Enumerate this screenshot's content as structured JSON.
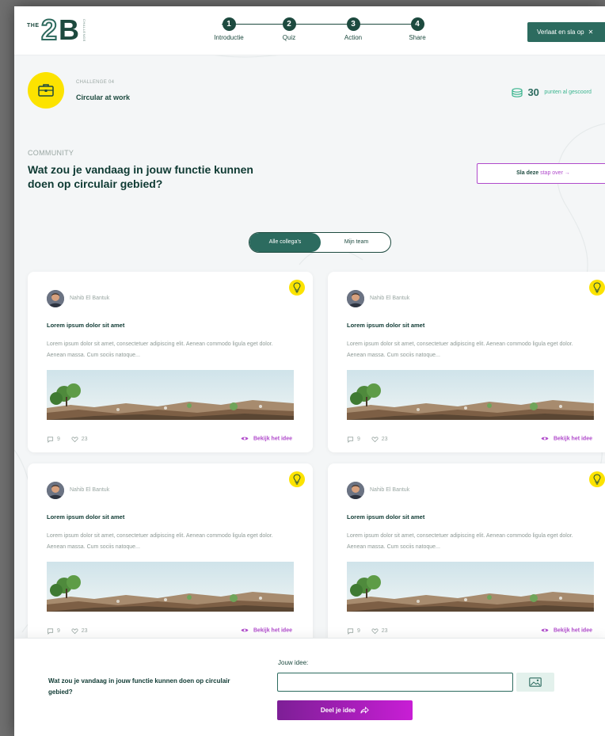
{
  "brand": {
    "the": "THE",
    "two": "2",
    "bee": "B",
    "sub": "CHALLENGE"
  },
  "steps": [
    {
      "num": "1",
      "label": "Introductie"
    },
    {
      "num": "2",
      "label": "Quiz"
    },
    {
      "num": "3",
      "label": "Action"
    },
    {
      "num": "4",
      "label": "Share"
    }
  ],
  "header": {
    "leave_label": "Verlaat en sla op",
    "leave_icon": "close-icon"
  },
  "challenge": {
    "kicker": "CHALLENGE 04",
    "title": "Circular at work",
    "icon": "briefcase-icon"
  },
  "points": {
    "value": "30",
    "text": "punten al gescoord",
    "icon": "coin-stack-icon"
  },
  "section": {
    "kicker": "COMMUNITY",
    "title": "Wat zou je vandaag in jouw functie kunnen doen op circulair gebied?",
    "skip_label": "Sla deze",
    "skip_emphasis": "stap over",
    "skip_arrow": "→"
  },
  "filter": {
    "options": [
      "Alle collega's",
      "Mijn team"
    ],
    "selected": "Alle collega's"
  },
  "cards": [
    {
      "author": "Nahib El Bantuk",
      "title": "Lorem ipsum dolor sit amet",
      "body": "Lorem ipsum dolor sit amet, consectetuer adipiscing elit. Aenean commodo ligula eget dolor. Aenean massa. Cum sociis natoque...",
      "comments": "9",
      "likes": "23",
      "view_label": "Bekijk het idee"
    },
    {
      "author": "Nahib El Bantuk",
      "title": "Lorem ipsum dolor sit amet",
      "body": "Lorem ipsum dolor sit amet, consectetuer adipiscing elit. Aenean commodo ligula eget dolor. Aenean massa. Cum sociis natoque...",
      "comments": "9",
      "likes": "23",
      "view_label": "Bekijk het idee"
    },
    {
      "author": "Nahib El Bantuk",
      "title": "Lorem ipsum dolor sit amet",
      "body": "Lorem ipsum dolor sit amet, consectetuer adipiscing elit. Aenean commodo ligula eget dolor. Aenean massa. Cum sociis natoque...",
      "comments": "9",
      "likes": "23",
      "view_label": "Bekijk het idee"
    },
    {
      "author": "Nahib El Bantuk",
      "title": "Lorem ipsum dolor sit amet",
      "body": "Lorem ipsum dolor sit amet, consectetuer adipiscing elit. Aenean commodo ligula eget dolor. Aenean massa. Cum sociis natoque...",
      "comments": "9",
      "likes": "23",
      "view_label": "Bekijk het idee"
    }
  ],
  "composer": {
    "question": "Wat zou je vandaag in jouw functie kunnen doen op circulair gebied?",
    "field_label": "Jouw idee:",
    "field_value": "",
    "share_label": "Deel je idee",
    "share_icon": "share-arrow-icon",
    "image_icon": "image-icon"
  },
  "colors": {
    "brand_green": "#1d4a3f",
    "button_green": "#2c6b5f",
    "accent_purple": "#b04acb",
    "badge_yellow": "#fce300",
    "background": "#f4f6f7"
  }
}
